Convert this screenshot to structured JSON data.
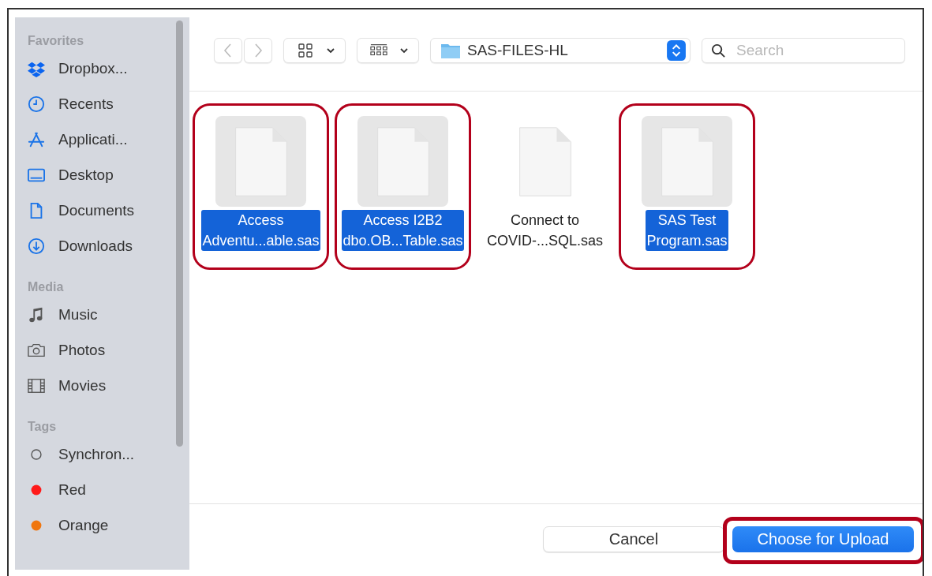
{
  "sidebar": {
    "sections": [
      {
        "heading": "Favorites",
        "items": [
          {
            "label": "Dropbox..."
          },
          {
            "label": "Recents"
          },
          {
            "label": "Applicati..."
          },
          {
            "label": "Desktop"
          },
          {
            "label": "Documents"
          },
          {
            "label": "Downloads"
          }
        ]
      },
      {
        "heading": "Media",
        "items": [
          {
            "label": "Music"
          },
          {
            "label": "Photos"
          },
          {
            "label": "Movies"
          }
        ]
      },
      {
        "heading": "Tags",
        "items": [
          {
            "label": "Synchron..."
          },
          {
            "label": "Red",
            "color": "#ff1a1a"
          },
          {
            "label": "Orange",
            "color": "#f0760f"
          }
        ]
      }
    ]
  },
  "toolbar": {
    "location": "SAS-FILES-HL",
    "search": {
      "placeholder": "Search"
    }
  },
  "files": [
    {
      "lines": [
        "Access",
        "Adventu...able.sas"
      ],
      "selected": true,
      "annotated": true
    },
    {
      "lines": [
        "Access I2B2",
        "dbo.OB...Table.sas"
      ],
      "selected": true,
      "annotated": true
    },
    {
      "lines": [
        "Connect to",
        "COVID-...SQL.sas"
      ],
      "selected": false,
      "annotated": false
    },
    {
      "lines": [
        "SAS Test",
        "Program.sas"
      ],
      "selected": true,
      "annotated": true
    }
  ],
  "buttons": [
    {
      "label": "Cancel",
      "kind": "secondary"
    },
    {
      "label": "Choose for Upload",
      "kind": "primary",
      "annotated": true
    }
  ]
}
